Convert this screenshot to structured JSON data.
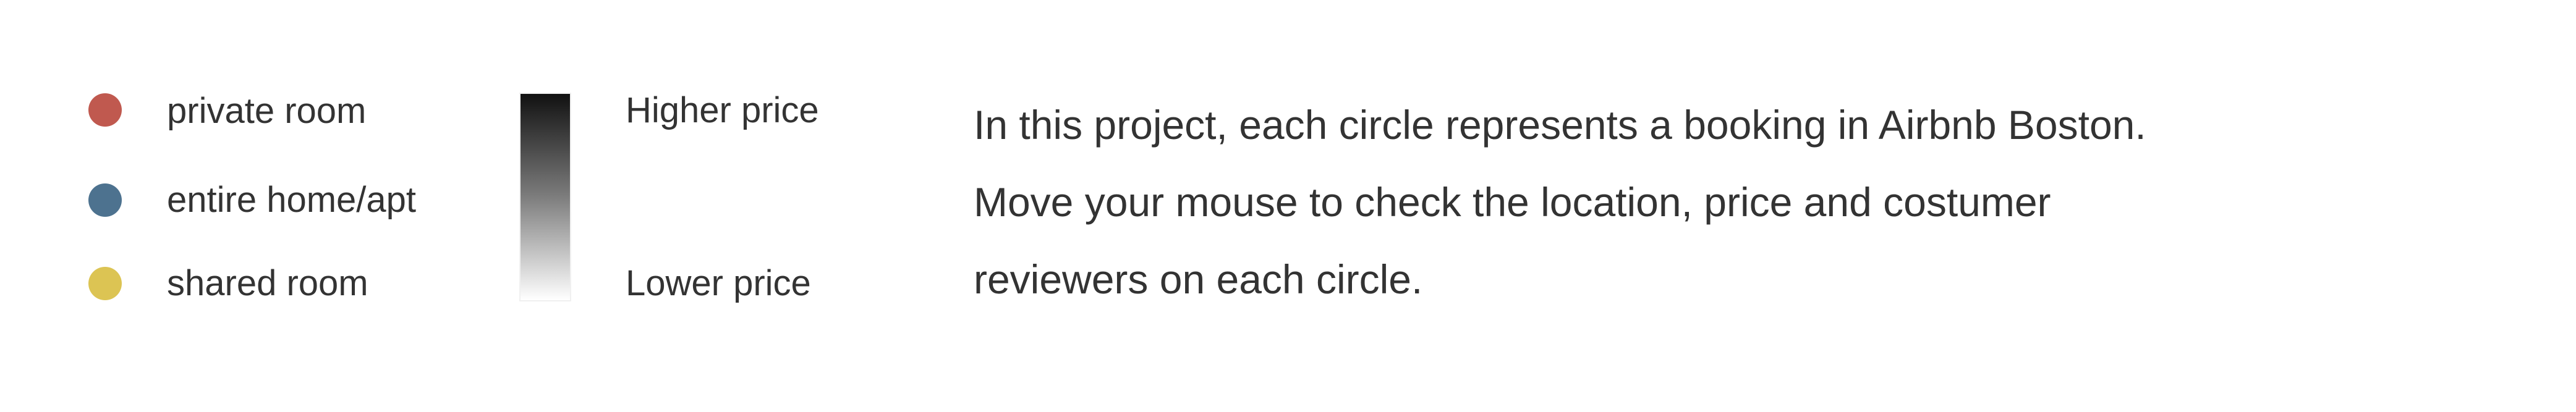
{
  "legend": {
    "items": [
      {
        "label": "private room",
        "color": "#c0594f"
      },
      {
        "label": "entire home/apt",
        "color": "#4d728f"
      },
      {
        "label": "shared room",
        "color": "#dcc453"
      }
    ]
  },
  "price_scale": {
    "high_label": "Higher price",
    "low_label": "Lower price",
    "gradient_top_color": "#111111",
    "gradient_bottom_color": "#ffffff"
  },
  "description": {
    "lines": [
      "In this project, each circle represents a booking in Airbnb Boston.",
      "Move your mouse to check the location, price and costumer",
      "reviewers on each circle."
    ]
  }
}
